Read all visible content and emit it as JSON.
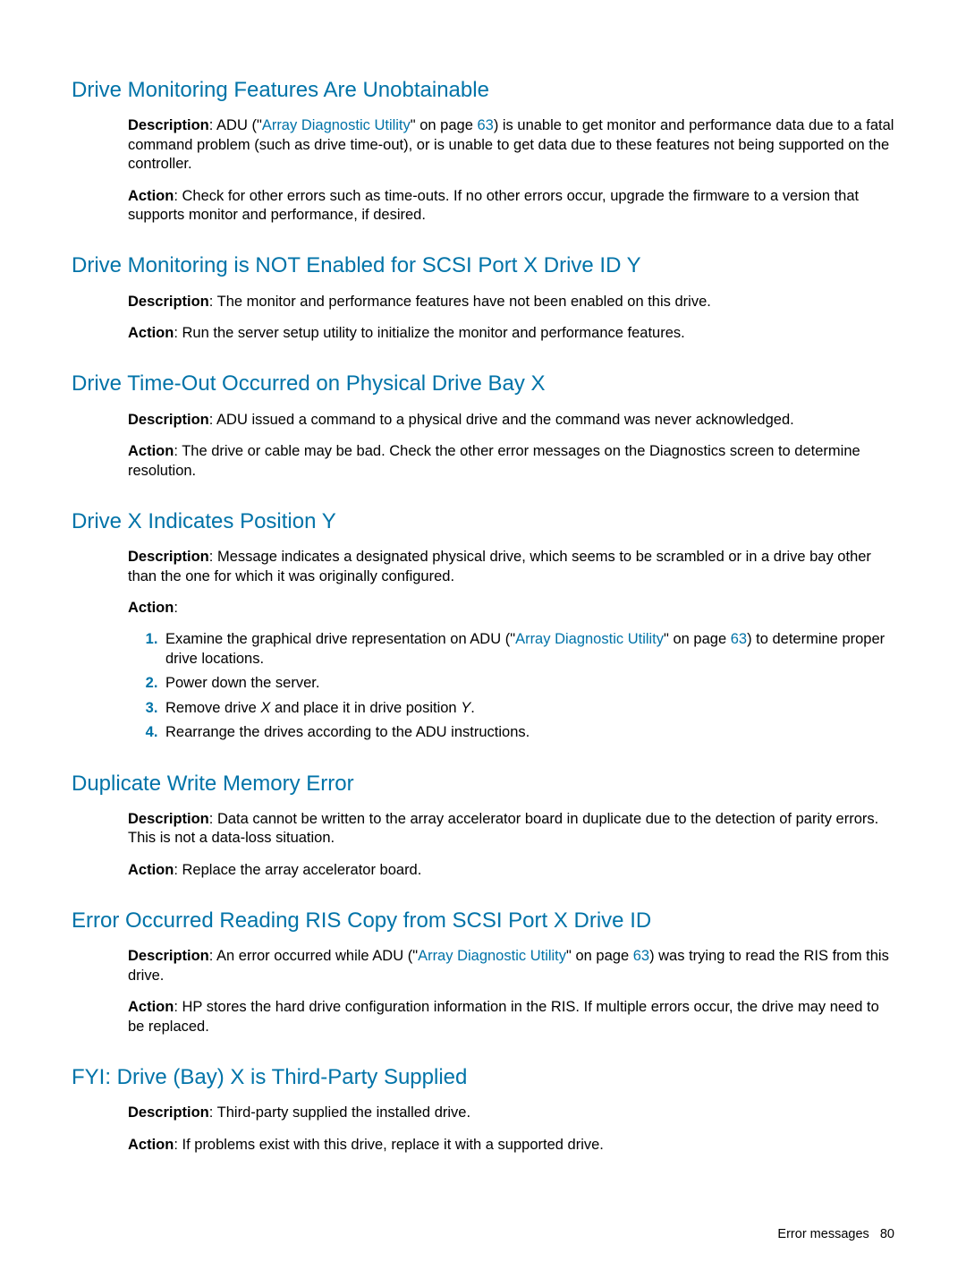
{
  "s1": {
    "title": "Drive Monitoring Features Are Unobtainable",
    "d_a": "Description",
    "d_b": ": ADU (\"",
    "d_link": "Array Diagnostic Utility",
    "d_c": "\" on page ",
    "d_page": "63",
    "d_d": ") is unable to get monitor and performance data due to a fatal command problem (such as drive time-out), or is unable to get data due to these features not being supported on the controller.",
    "a_a": "Action",
    "a_b": ": Check for other errors such as time-outs. If no other errors occur, upgrade the firmware to a version that supports monitor and performance, if desired."
  },
  "s2": {
    "title": "Drive Monitoring is NOT Enabled for SCSI Port X Drive ID Y",
    "d_a": "Description",
    "d_b": ": The monitor and performance features have not been enabled on this drive.",
    "a_a": "Action",
    "a_b": ": Run the server setup utility to initialize the monitor and performance features."
  },
  "s3": {
    "title": "Drive Time-Out Occurred on Physical Drive Bay X",
    "d_a": "Description",
    "d_b": ": ADU issued a command to a physical drive and the command was never acknowledged.",
    "a_a": "Action",
    "a_b": ": The drive or cable may be bad. Check the other error messages on the Diagnostics screen to determine resolution."
  },
  "s4": {
    "title": "Drive X Indicates Position Y",
    "d_a": "Description",
    "d_b": ": Message indicates a designated physical drive, which seems to be scrambled or in a drive bay other than the one for which it was originally configured.",
    "a_a": "Action",
    "a_b": ":",
    "l1a": "Examine the graphical drive representation on ADU (\"",
    "l1link": "Array Diagnostic Utility",
    "l1b": "\" on page ",
    "l1page": "63",
    "l1c": ") to determine proper drive locations.",
    "l2": "Power down the server.",
    "l3a": "Remove drive ",
    "l3x": "X",
    "l3b": " and place it in drive position ",
    "l3y": "Y",
    "l3c": ".",
    "l4": "Rearrange the drives according to the ADU instructions."
  },
  "s5": {
    "title": "Duplicate Write Memory Error",
    "d_a": "Description",
    "d_b": ": Data cannot be written to the array accelerator board in duplicate due to the detection of parity errors. This is not a data-loss situation.",
    "a_a": "Action",
    "a_b": ": Replace the array accelerator board."
  },
  "s6": {
    "title": "Error Occurred Reading RIS Copy from SCSI Port X Drive ID",
    "d_a": "Description",
    "d_b": ": An error occurred while ADU (\"",
    "d_link": "Array Diagnostic Utility",
    "d_c": "\" on page ",
    "d_page": "63",
    "d_d": ") was trying to read the RIS from this drive.",
    "a_a": "Action",
    "a_b": ": HP stores the hard drive configuration information in the RIS. If multiple errors occur, the drive may need to be replaced."
  },
  "s7": {
    "title": "FYI: Drive (Bay) X is Third-Party Supplied",
    "d_a": "Description",
    "d_b": ": Third-party supplied the installed drive.",
    "a_a": "Action",
    "a_b": ": If problems exist with this drive, replace it with a supported drive."
  },
  "footer": {
    "label": "Error messages",
    "page": "80"
  }
}
